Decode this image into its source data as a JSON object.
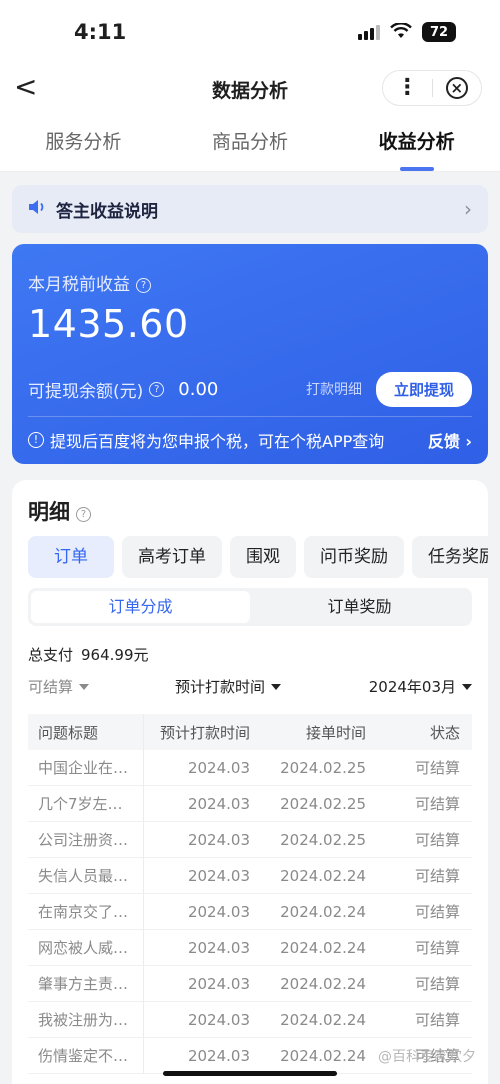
{
  "status": {
    "time": "4:11",
    "battery": "72"
  },
  "nav": {
    "back_label": "<",
    "title": "数据分析",
    "more_label": "⋮",
    "close_label": "×"
  },
  "tabs": [
    {
      "label": "服务分析"
    },
    {
      "label": "商品分析"
    },
    {
      "label": "收益分析"
    }
  ],
  "notice": {
    "text": "答主收益说明"
  },
  "income": {
    "label": "本月税前收益",
    "value": "1435.60",
    "withdraw_label": "可提现余额(元)",
    "withdraw_amount": "0.00",
    "detail_link": "打款明细",
    "withdraw_button": "立即提现",
    "tip_text": "提现后百度将为您申报个税，可在个税APP查询",
    "feedback_link": "反馈"
  },
  "detail": {
    "title": "明细",
    "chips": [
      {
        "label": "订单"
      },
      {
        "label": "高考订单"
      },
      {
        "label": "围观"
      },
      {
        "label": "问币奖励"
      },
      {
        "label": "任务奖励"
      }
    ],
    "segments": [
      {
        "label": "订单分成"
      },
      {
        "label": "订单奖励"
      }
    ],
    "total_label": "总支付",
    "total_amount": "964.99元",
    "filters": {
      "status": "可结算",
      "time": "预计打款时间",
      "month": "2024年03月"
    },
    "table": {
      "headers": [
        "问题标题",
        "预计打款时间",
        "接单时间",
        "状态"
      ],
      "rows": [
        {
          "title": "中国企业在…",
          "pay": "2024.03",
          "accept": "2024.02.25",
          "status": "可结算"
        },
        {
          "title": "几个7岁左…",
          "pay": "2024.03",
          "accept": "2024.02.25",
          "status": "可结算"
        },
        {
          "title": "公司注册资…",
          "pay": "2024.03",
          "accept": "2024.02.25",
          "status": "可结算"
        },
        {
          "title": "失信人员最…",
          "pay": "2024.03",
          "accept": "2024.02.24",
          "status": "可结算"
        },
        {
          "title": "在南京交了…",
          "pay": "2024.03",
          "accept": "2024.02.24",
          "status": "可结算"
        },
        {
          "title": "网恋被人威…",
          "pay": "2024.03",
          "accept": "2024.02.24",
          "status": "可结算"
        },
        {
          "title": "肇事方主责…",
          "pay": "2024.03",
          "accept": "2024.02.24",
          "status": "可结算"
        },
        {
          "title": "我被注册为…",
          "pay": "2024.03",
          "accept": "2024.02.24",
          "status": "可结算"
        },
        {
          "title": "伤情鉴定不…",
          "pay": "2024.03",
          "accept": "2024.02.24",
          "status": "可结算"
        }
      ]
    }
  },
  "watermark": "@百科专家欢夕"
}
